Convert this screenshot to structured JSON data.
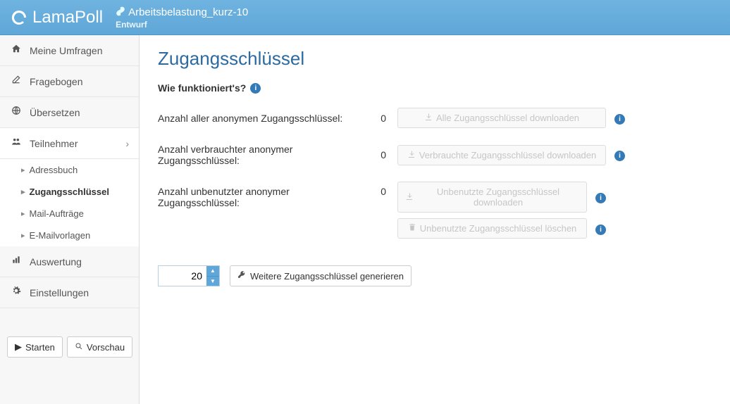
{
  "app": {
    "name": "LamaPoll"
  },
  "poll": {
    "name": "Arbeitsbelastung_kurz-10",
    "status": "Entwurf"
  },
  "sidebar": {
    "items": {
      "surveys": "Meine Umfragen",
      "questionnaire": "Fragebogen",
      "translate": "Übersetzen",
      "participants": "Teilnehmer",
      "evaluation": "Auswertung",
      "settings": "Einstellungen"
    },
    "sub": {
      "addressbook": "Adressbuch",
      "accesskeys": "Zugangsschlüssel",
      "mailjobs": "Mail-Aufträge",
      "mailtemplates": "E-Mailvorlagen"
    },
    "buttons": {
      "start": "Starten",
      "preview": "Vorschau"
    }
  },
  "main": {
    "title": "Zugangsschlüssel",
    "how_works": "Wie funktioniert's?",
    "rows": {
      "all": {
        "label": "Anzahl aller anonymen Zugangsschlüssel:",
        "count": "0",
        "btn": "Alle Zugangsschlüssel downloaden"
      },
      "used": {
        "label": "Anzahl verbrauchter anonymer Zugangsschlüssel:",
        "count": "0",
        "btn": "Verbrauchte Zugangsschlüssel downloaden"
      },
      "unused": {
        "label": "Anzahl unbenutzter anonymer Zugangsschlüssel:",
        "count": "0",
        "btn": "Unbenutzte Zugangsschlüssel downloaden",
        "btn2": "Unbenutzte Zugangsschlüssel löschen"
      }
    },
    "generate": {
      "value": "20",
      "btn": "Weitere Zugangsschlüssel generieren"
    }
  }
}
